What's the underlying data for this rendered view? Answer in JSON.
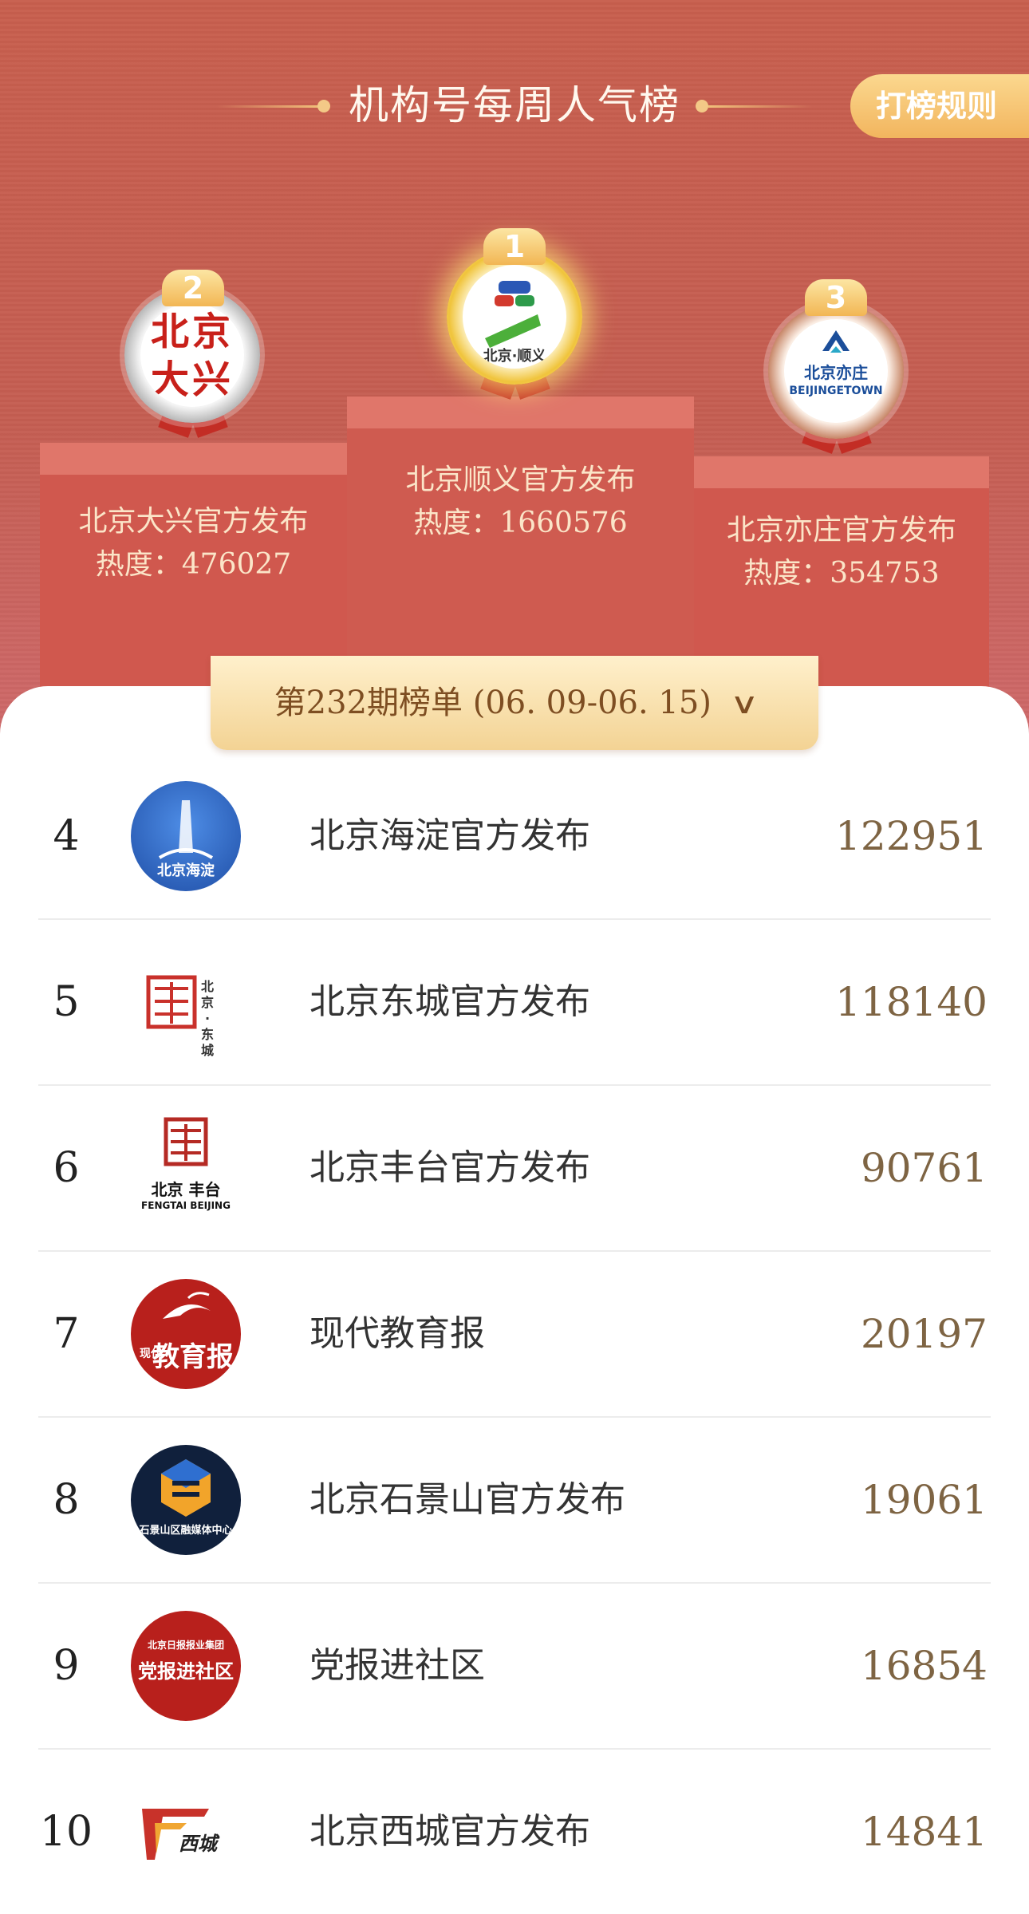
{
  "header": {
    "title": "机构号每周人气榜",
    "rules_button": "打榜规则"
  },
  "podium": [
    {
      "rank": "2",
      "name": "北京大兴官方发布",
      "heat_label": "热度：",
      "heat": "476027",
      "logo_text": "北京大兴"
    },
    {
      "rank": "1",
      "name": "北京顺义官方发布",
      "heat_label": "热度：",
      "heat": "1660576",
      "logo_text": "北京·顺义"
    },
    {
      "rank": "3",
      "name": "北京亦庄官方发布",
      "heat_label": "热度：",
      "heat": "354753",
      "logo_text": "北京亦庄",
      "logo_subtext": "BEIJINGETOWN"
    }
  ],
  "period": {
    "label": "第232期榜单 (06. 09-06. 15)"
  },
  "list": [
    {
      "rank": "4",
      "name": "北京海淀官方发布",
      "score": "122951",
      "logo_text": "北京海淀",
      "logo_color": "#2a5fb8"
    },
    {
      "rank": "5",
      "name": "北京东城官方发布",
      "score": "118140",
      "logo_text": "北京·东城",
      "logo_color": "#c9312b"
    },
    {
      "rank": "6",
      "name": "北京丰台官方发布",
      "score": "90761",
      "logo_text": "北京 丰台",
      "logo_subtext": "FENGTAI BEIJING",
      "logo_color": "#b52a24"
    },
    {
      "rank": "7",
      "name": "现代教育报",
      "score": "20197",
      "logo_text": "教育报",
      "logo_small": "现代",
      "logo_color": "#b8201c"
    },
    {
      "rank": "8",
      "name": "北京石景山官方发布",
      "score": "19061",
      "logo_text": "石景山区融媒体中心",
      "logo_color": "#10203c"
    },
    {
      "rank": "9",
      "name": "党报进社区",
      "score": "16854",
      "logo_text": "党报进社区",
      "logo_small": "北京日报报业集团",
      "logo_color": "#b8201c"
    },
    {
      "rank": "10",
      "name": "北京西城官方发布",
      "score": "14841",
      "logo_text": "西城",
      "logo_color": "#c8322a"
    }
  ]
}
